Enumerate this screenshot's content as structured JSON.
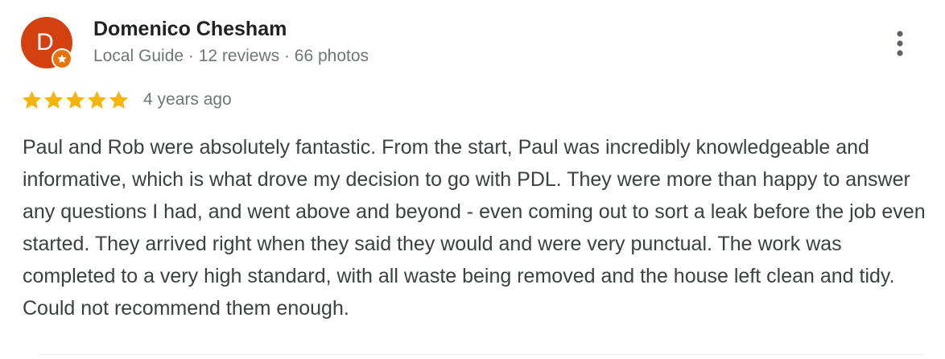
{
  "review": {
    "author": {
      "initial": "D",
      "name": "Domenico Chesham",
      "meta": "Local Guide · 12 reviews · 66 photos",
      "avatar_color": "#d2410f",
      "badge_color": "#e8720c",
      "badge_icon": "star-icon"
    },
    "rating": {
      "stars": 5,
      "max_stars": 5,
      "star_color": "#f5b50e"
    },
    "time_ago": "4 years ago",
    "text": "Paul and Rob were absolutely fantastic. From the start, Paul was incredibly knowledgeable and informative, which is what drove my decision to go with PDL. They were more than happy to answer any questions I had, and went above and beyond - even coming out to sort a leak before the job even started. They arrived right when they said they would and were very punctual. The work was completed to a very high standard, with all waste being removed and the house left clean and tidy. Could not recommend them enough.",
    "menu_icon": "more-vert-icon"
  }
}
